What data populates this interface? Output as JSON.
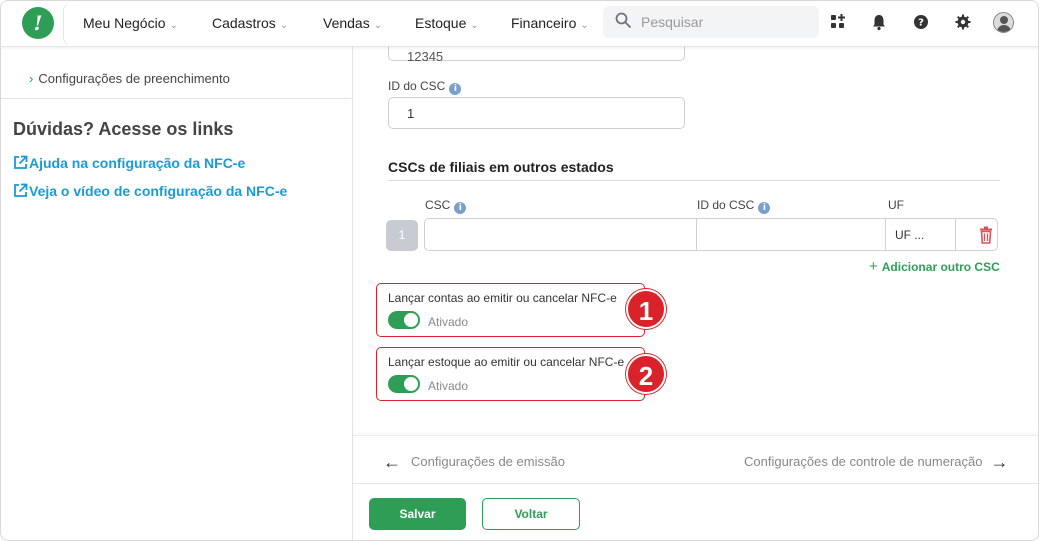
{
  "nav": {
    "items": [
      {
        "label": "Meu Negócio"
      },
      {
        "label": "Cadastros"
      },
      {
        "label": "Vendas"
      },
      {
        "label": "Estoque"
      },
      {
        "label": "Financeiro"
      }
    ],
    "search_placeholder": "Pesquisar"
  },
  "sidebar": {
    "crumb": "Configurações de preenchimento",
    "help_heading": "Dúvidas? Acesse os links",
    "links": [
      {
        "label": "Ajuda na configuração da NFC-e"
      },
      {
        "label": "Veja o vídeo de configuração da NFC-e"
      }
    ]
  },
  "form": {
    "top_field_value": "12345",
    "id_csc_label": "ID do CSC",
    "id_csc_value": "1",
    "section_title": "CSCs de filiais em outros estados",
    "table": {
      "col_csc": "CSC",
      "col_id_csc": "ID do CSC",
      "col_uf": "UF",
      "row_index": "1",
      "uf_value": "UF ..."
    },
    "add_link": "Adicionar outro CSC",
    "toggles": [
      {
        "label": "Lançar contas ao emitir ou cancelar NFC-e",
        "state": "Ativado",
        "badge": "1",
        "on": true
      },
      {
        "label": "Lançar estoque ao emitir ou cancelar NFC-e",
        "state": "Ativado",
        "badge": "2",
        "on": true
      }
    ]
  },
  "footer": {
    "prev": "Configurações de emissão",
    "next": "Configurações de controle de numeração",
    "save": "Salvar",
    "back": "Voltar"
  },
  "colors": {
    "brand_green": "#2e9e57",
    "highlight_red": "#d9222a",
    "link_blue": "#1a9bd7"
  }
}
